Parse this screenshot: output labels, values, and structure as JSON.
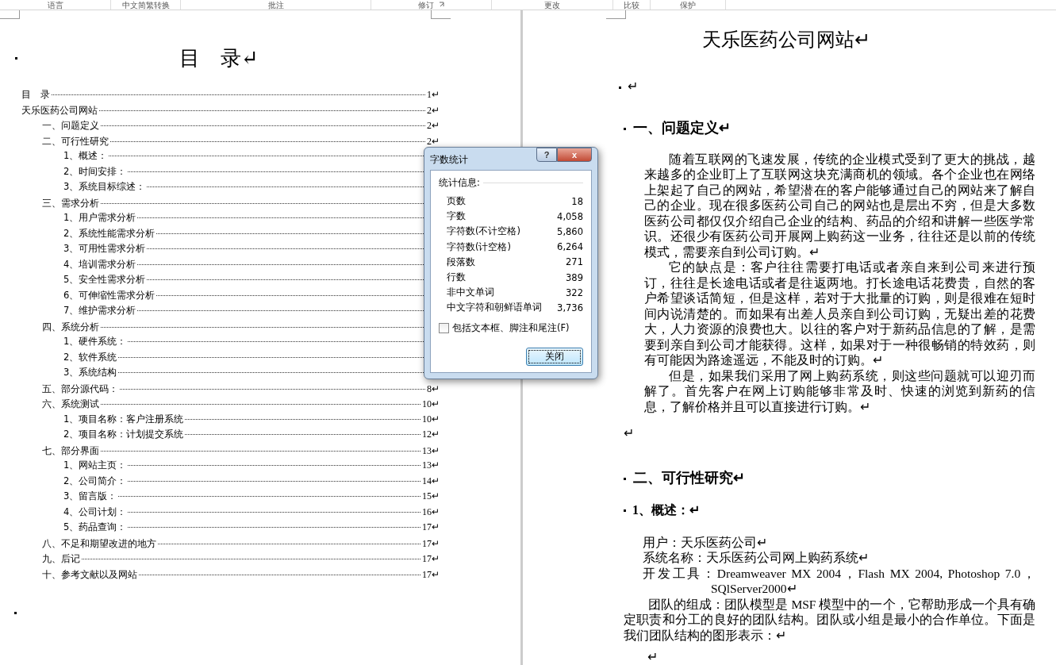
{
  "ribbon_groups": [
    {
      "label": "语言",
      "launcher": false
    },
    {
      "label": "中文简繁转换",
      "launcher": false
    },
    {
      "label": "批注",
      "launcher": false
    },
    {
      "label": "修订",
      "launcher": true
    },
    {
      "label": "更改",
      "launcher": false
    },
    {
      "label": "比较",
      "launcher": false
    },
    {
      "label": "保护",
      "launcher": false
    }
  ],
  "left_page": {
    "title": "目　录↵",
    "toc": [
      {
        "text": "目　录",
        "page": "1↵"
      },
      {
        "text": "天乐医药公司网站",
        "page": "2↵",
        "children": [
          {
            "text": "一、问题定义",
            "page": "2↵"
          },
          {
            "text": "二、可行性研究",
            "page": "2↵",
            "children": [
              {
                "text": "1、概述："
              },
              {
                "text": "2、时间安排："
              },
              {
                "text": "3、系统目标综述："
              }
            ]
          },
          {
            "text": "三、需求分析",
            "children": [
              {
                "text": "1、用户需求分析"
              },
              {
                "text": "2、系统性能需求分析"
              },
              {
                "text": "3、可用性需求分析"
              },
              {
                "text": "4、培训需求分析"
              },
              {
                "text": "5、安全性需求分析"
              },
              {
                "text": "6、可伸缩性需求分析"
              },
              {
                "text": "7、维护需求分析"
              }
            ]
          },
          {
            "text": "四、系统分析",
            "children": [
              {
                "text": "1、硬件系统："
              },
              {
                "text": "2、软件系统"
              },
              {
                "text": "3、系统结构"
              }
            ]
          },
          {
            "text": "五、部分源代码：",
            "page": "8↵"
          },
          {
            "text": "六、系统测试",
            "page": "10↵",
            "children": [
              {
                "text": "1、项目名称：客户注册系统",
                "page": "10↵"
              },
              {
                "text": "2、项目名称：计划提交系统",
                "page": "12↵"
              }
            ]
          },
          {
            "text": "七、部分界面",
            "page": "13↵",
            "children": [
              {
                "text": "1、网站主页：",
                "page": "13↵"
              },
              {
                "text": "2、公司简介：",
                "page": "14↵"
              },
              {
                "text": "3、留言版：",
                "page": "15↵"
              },
              {
                "text": "4、公司计划：",
                "page": "16↵"
              },
              {
                "text": "5、药品查询：",
                "page": "17↵"
              }
            ]
          },
          {
            "text": "八、不足和期望改进的地方",
            "page": "17↵"
          },
          {
            "text": "九、后记",
            "page": "17↵"
          },
          {
            "text": "十、参考文献以及网站",
            "page": "17↵"
          }
        ]
      }
    ]
  },
  "right_page": {
    "blocks": [
      {
        "kind": "title",
        "text": "天乐医药公司网站↵",
        "marker": false
      },
      {
        "kind": "empty",
        "text": "↵",
        "marker": true
      },
      {
        "kind": "heading1",
        "text": "一、问题定义↵",
        "marker": true
      },
      {
        "kind": "body",
        "text": "随着互联网的飞速发展，传统的企业模式受到了更大的挑战，越来越多的企业盯上了互联网这块充满商机的领域。各个企业也在网络上架起了自己的网站，希望潜在的客户能够通过自己的网站来了解自己的企业。现在很多医药公司自己的网站也是层出不穷，但是大多数医药公司都仅仅介绍自己企业的结构、药品的介绍和讲解一些医学常识。还很少有医药公司开展网上购药这一业务，往往还是以前的传统模式，需要亲自到公司订购。↵",
        "marker": false
      },
      {
        "kind": "body",
        "text": "它的缺点是：客户往往需要打电话或者亲自来到公司来进行预订，往往是长途电话或者是往返两地。打长途电话花费贵，自然的客户希望谈话简短，但是这样，若对于大批量的订购，则是很难在短时间内说清楚的。而如果有出差人员亲自到公司订购，无疑出差的花费大，人力资源的浪费也大。以往的客户对于新药品信息的了解，是需要到亲自到公司才能获得。这样，如果对于一种很畅销的特效药，则有可能因为路途遥远，不能及时的订购。↵",
        "marker": false
      },
      {
        "kind": "body",
        "text": "但是，如果我们采用了网上购药系统，则这些问题就可以迎刃而解了。首先客户在网上订购能够非常及时、快速的浏览到新药的信息，了解价格并且可以直接进行订购。↵",
        "marker": false
      },
      {
        "kind": "empty",
        "text": "↵",
        "marker": false
      },
      {
        "kind": "heading1",
        "text": "二、可行性研究↵",
        "marker": true
      },
      {
        "kind": "heading2",
        "text": "1、概述：↵",
        "marker": true
      },
      {
        "kind": "line",
        "text": "用户：天乐医药公司↵",
        "marker": false
      },
      {
        "kind": "line",
        "text": "系统名称：天乐医药公司网上购药系统↵",
        "marker": false
      },
      {
        "kind": "hanging",
        "text": "开发工具：Dreamweaver MX 2004，Flash MX 2004, Photoshop 7.0，SQlServer2000↵",
        "marker": false
      },
      {
        "kind": "wide",
        "text": "团队的组成：团队模型是 MSF 模型中的一个，它帮助形成一个具有确定职责和分工的良好的团队结构。团队或小组是最小的合作单位。下面是我们团队结构的图形表示：↵",
        "marker": false
      },
      {
        "kind": "empty2",
        "text": "↵",
        "marker": false
      }
    ]
  },
  "dialog": {
    "title": "字数统计",
    "group_label": "统计信息:",
    "stats": [
      {
        "label": "页数",
        "value": "18"
      },
      {
        "label": "字数",
        "value": "4,058"
      },
      {
        "label": "字符数(不计空格)",
        "value": "5,860"
      },
      {
        "label": "字符数(计空格)",
        "value": "6,264"
      },
      {
        "label": "段落数",
        "value": "271"
      },
      {
        "label": "行数",
        "value": "389"
      },
      {
        "label": "非中文单词",
        "value": "322"
      },
      {
        "label": "中文字符和朝鲜语单词",
        "value": "3,736"
      }
    ],
    "checkbox": {
      "label": "包括文本框、脚注和尾注(F)",
      "checked": false
    },
    "help_button": "?",
    "close_icon": "x",
    "close_button": "关闭"
  }
}
